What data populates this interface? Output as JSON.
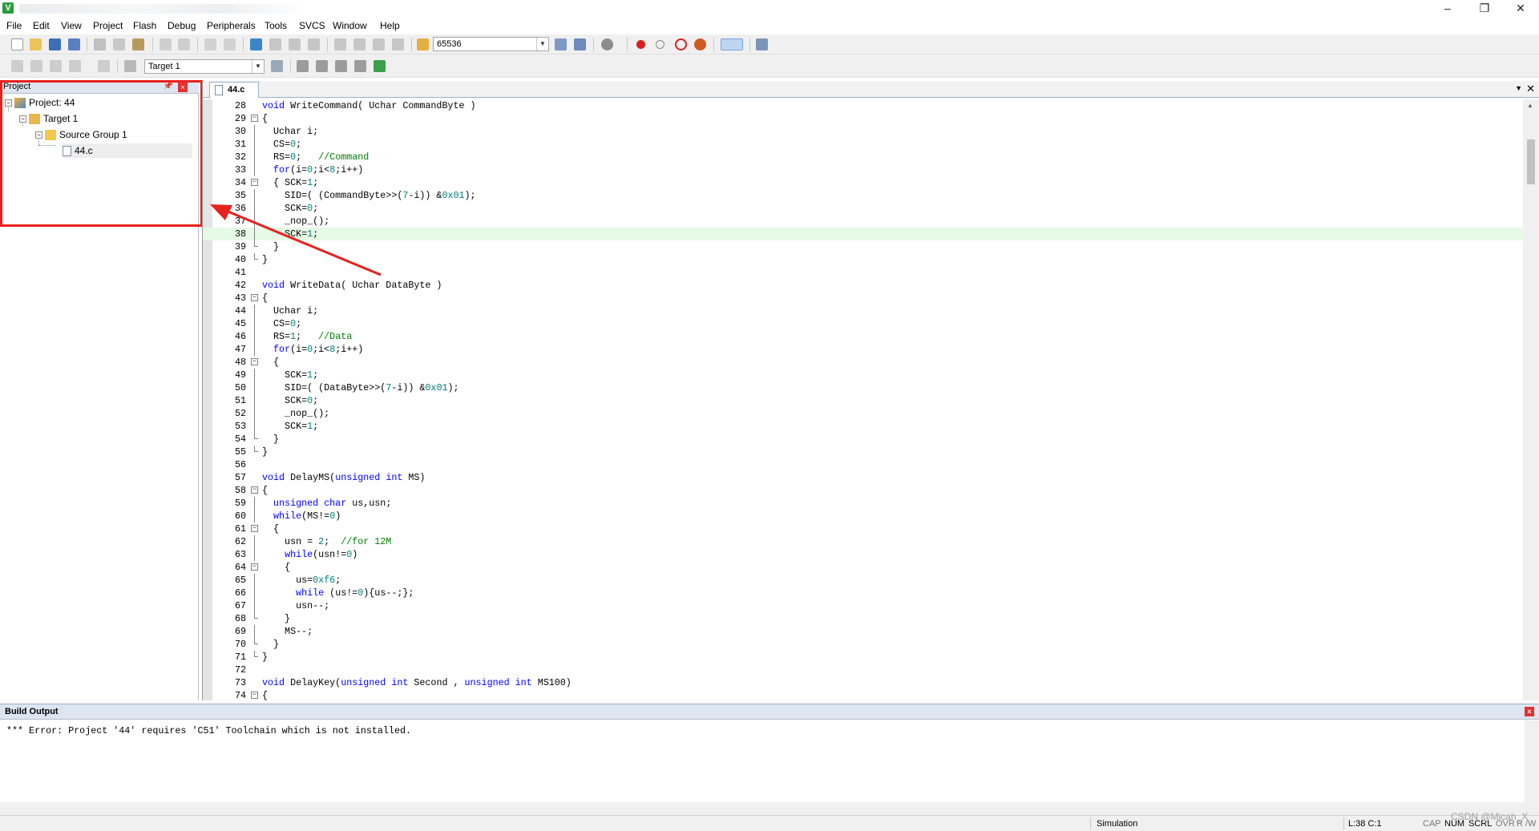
{
  "menu": [
    "File",
    "Edit",
    "View",
    "Project",
    "Flash",
    "Debug",
    "Peripherals",
    "Tools",
    "SVCS",
    "Window",
    "Help"
  ],
  "toolbar": {
    "combo_value": "65536",
    "target_value": "Target 1"
  },
  "project": {
    "panel_title": "Project",
    "tree": [
      {
        "label": "Project: 44"
      },
      {
        "label": "Target 1"
      },
      {
        "label": "Source Group 1"
      },
      {
        "label": "44.c"
      }
    ]
  },
  "editor": {
    "tab_label": "44.c",
    "current_line": 38,
    "lines": [
      {
        "n": "28",
        "fold": "",
        "html": "<span class=\"kw\">void</span> WriteCommand( Uchar CommandByte )"
      },
      {
        "n": "29",
        "fold": "box",
        "html": "{"
      },
      {
        "n": "30",
        "fold": "line",
        "html": "  Uchar i;"
      },
      {
        "n": "31",
        "fold": "line",
        "html": "  CS=<span class=\"nm\">0</span>;"
      },
      {
        "n": "32",
        "fold": "line",
        "html": "  RS=<span class=\"nm\">0</span>;   <span class=\"cm\">//Command</span>"
      },
      {
        "n": "33",
        "fold": "line",
        "html": "  <span class=\"kw\">for</span>(i=<span class=\"nm\">0</span>;i&lt;<span class=\"nm\">8</span>;i++)"
      },
      {
        "n": "34",
        "fold": "box",
        "html": "  { SCK=<span class=\"nm\">1</span>;"
      },
      {
        "n": "35",
        "fold": "line",
        "html": "    SID=( (CommandByte&gt;&gt;(<span class=\"nm\">7</span>-i)) &amp;<span class=\"nm\">0x01</span>);"
      },
      {
        "n": "36",
        "fold": "line",
        "html": "    SCK=<span class=\"nm\">0</span>;"
      },
      {
        "n": "37",
        "fold": "line",
        "html": "    _nop_();"
      },
      {
        "n": "38",
        "fold": "line",
        "html": "    SCK=<span class=\"nm\">1</span>;"
      },
      {
        "n": "39",
        "fold": "end",
        "html": "  }"
      },
      {
        "n": "40",
        "fold": "end",
        "html": "}"
      },
      {
        "n": "41",
        "fold": "",
        "html": ""
      },
      {
        "n": "42",
        "fold": "",
        "html": "<span class=\"kw\">void</span> WriteData( Uchar DataByte )"
      },
      {
        "n": "43",
        "fold": "box",
        "html": "{"
      },
      {
        "n": "44",
        "fold": "line",
        "html": "  Uchar i;"
      },
      {
        "n": "45",
        "fold": "line",
        "html": "  CS=<span class=\"nm\">0</span>;"
      },
      {
        "n": "46",
        "fold": "line",
        "html": "  RS=<span class=\"nm\">1</span>;   <span class=\"cm\">//Data</span>"
      },
      {
        "n": "47",
        "fold": "line",
        "html": "  <span class=\"kw\">for</span>(i=<span class=\"nm\">0</span>;i&lt;<span class=\"nm\">8</span>;i++)"
      },
      {
        "n": "48",
        "fold": "box",
        "html": "  {"
      },
      {
        "n": "49",
        "fold": "line",
        "html": "    SCK=<span class=\"nm\">1</span>;"
      },
      {
        "n": "50",
        "fold": "line",
        "html": "    SID=( (DataByte&gt;&gt;(<span class=\"nm\">7</span>-i)) &amp;<span class=\"nm\">0x01</span>);"
      },
      {
        "n": "51",
        "fold": "line",
        "html": "    SCK=<span class=\"nm\">0</span>;"
      },
      {
        "n": "52",
        "fold": "line",
        "html": "    _nop_();"
      },
      {
        "n": "53",
        "fold": "line",
        "html": "    SCK=<span class=\"nm\">1</span>;"
      },
      {
        "n": "54",
        "fold": "end",
        "html": "  }"
      },
      {
        "n": "55",
        "fold": "end",
        "html": "}"
      },
      {
        "n": "56",
        "fold": "",
        "html": ""
      },
      {
        "n": "57",
        "fold": "",
        "html": "<span class=\"kw\">void</span> DelayMS(<span class=\"kw\">unsigned</span> <span class=\"kw\">int</span> MS)"
      },
      {
        "n": "58",
        "fold": "box",
        "html": "{"
      },
      {
        "n": "59",
        "fold": "line",
        "html": "  <span class=\"kw\">unsigned</span> <span class=\"kw\">char</span> us,usn;"
      },
      {
        "n": "60",
        "fold": "line",
        "html": "  <span class=\"kw\">while</span>(MS!=<span class=\"nm\">0</span>)"
      },
      {
        "n": "61",
        "fold": "box",
        "html": "  {"
      },
      {
        "n": "62",
        "fold": "line",
        "html": "    usn = <span class=\"nm\">2</span>;  <span class=\"cm\">//for 12M</span>"
      },
      {
        "n": "63",
        "fold": "line",
        "html": "    <span class=\"kw\">while</span>(usn!=<span class=\"nm\">0</span>)"
      },
      {
        "n": "64",
        "fold": "box",
        "html": "    {"
      },
      {
        "n": "65",
        "fold": "line",
        "html": "      us=<span class=\"nm\">0xf6</span>;"
      },
      {
        "n": "66",
        "fold": "line",
        "html": "      <span class=\"kw\">while</span> (us!=<span class=\"nm\">0</span>){us--;};"
      },
      {
        "n": "67",
        "fold": "line",
        "html": "      usn--;"
      },
      {
        "n": "68",
        "fold": "end",
        "html": "    }"
      },
      {
        "n": "69",
        "fold": "line",
        "html": "    MS--;"
      },
      {
        "n": "70",
        "fold": "end",
        "html": "  }"
      },
      {
        "n": "71",
        "fold": "end",
        "html": "}"
      },
      {
        "n": "72",
        "fold": "",
        "html": ""
      },
      {
        "n": "73",
        "fold": "",
        "html": "<span class=\"kw\">void</span> DelayKey(<span class=\"kw\">unsigned</span> <span class=\"kw\">int</span> Second , <span class=\"kw\">unsigned</span> <span class=\"kw\">int</span> MS100)"
      },
      {
        "n": "74",
        "fold": "box",
        "html": "{"
      }
    ]
  },
  "build": {
    "title": "Build Output",
    "text": "*** Error: Project '44' requires 'C51' Toolchain which is not installed."
  },
  "status": {
    "mode": "Simulation",
    "position": "L:38 C:1",
    "caps": "CAP",
    "num": "NUM",
    "scrl": "SCRL",
    "ovr": "OVR",
    "rw": "R /W"
  },
  "watermark": "CSDN @Micah_X",
  "colors": {
    "keyword": "#0000ff",
    "comment": "#008000",
    "number": "#008080",
    "annotation": "#e8211d",
    "current_line": "#e7fae5"
  }
}
